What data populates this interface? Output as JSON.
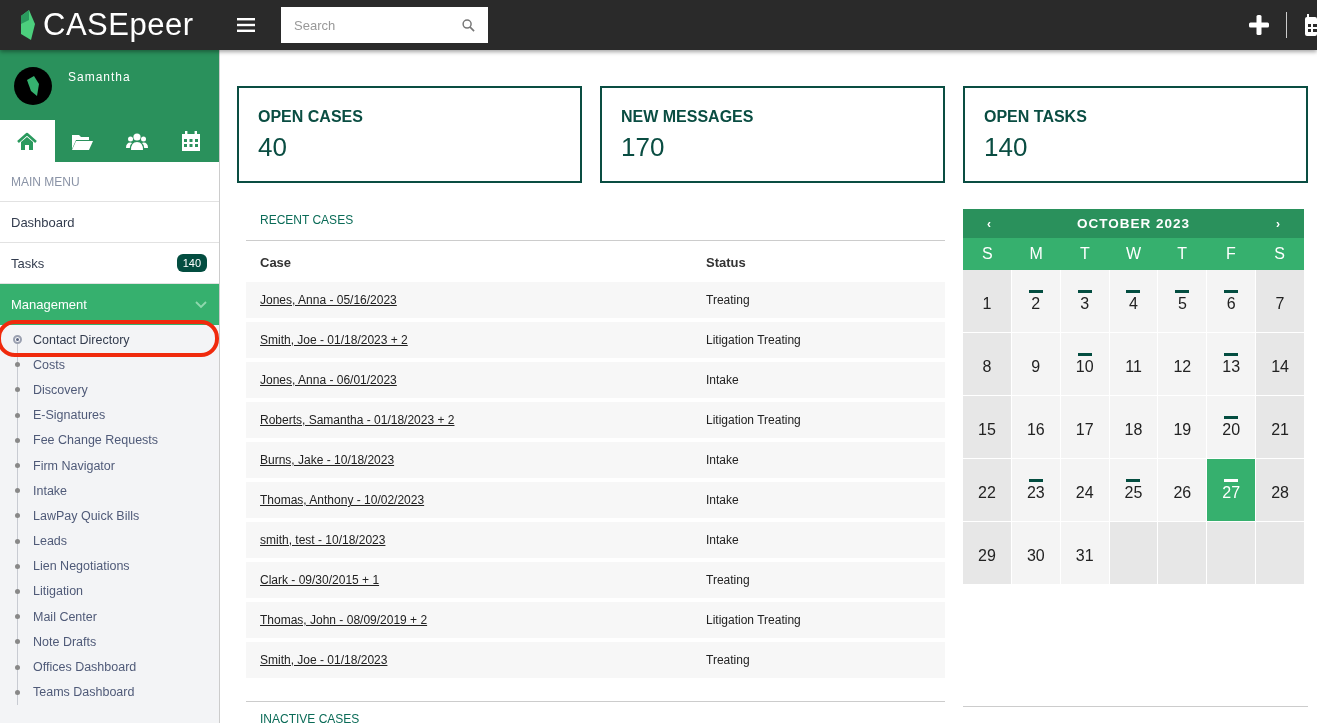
{
  "header": {
    "brand": "CASEpeer",
    "search": {
      "placeholder": "Search"
    }
  },
  "user": {
    "name": "Samantha"
  },
  "sidebar_tabs": [
    {
      "selected": true
    },
    {
      "selected": false
    },
    {
      "selected": false
    },
    {
      "selected": false
    }
  ],
  "sidebar": {
    "heading": "MAIN MENU",
    "items": [
      {
        "label": "Dashboard",
        "selected": false
      },
      {
        "label": "Tasks",
        "badge": "140",
        "selected": false
      },
      {
        "label": "Management",
        "selected": true,
        "expanded": true,
        "children": [
          {
            "label": "Contact Directory",
            "selected": true,
            "highlighted": true
          },
          {
            "label": "Costs",
            "selected": false
          },
          {
            "label": "Discovery",
            "selected": false
          },
          {
            "label": "E-Signatures",
            "selected": false
          },
          {
            "label": "Fee Change Requests",
            "selected": false
          },
          {
            "label": "Firm Navigator",
            "selected": false
          },
          {
            "label": "Intake",
            "selected": false
          },
          {
            "label": "LawPay Quick Bills",
            "selected": false
          },
          {
            "label": "Leads",
            "selected": false
          },
          {
            "label": "Lien Negotiations",
            "selected": false
          },
          {
            "label": "Litigation",
            "selected": false
          },
          {
            "label": "Mail Center",
            "selected": false
          },
          {
            "label": "Note Drafts",
            "selected": false
          },
          {
            "label": "Offices Dashboard",
            "selected": false
          },
          {
            "label": "Teams Dashboard",
            "selected": false
          }
        ]
      }
    ]
  },
  "stats": [
    {
      "label": "OPEN CASES",
      "value": "40"
    },
    {
      "label": "NEW MESSAGES",
      "value": "170"
    },
    {
      "label": "OPEN TASKS",
      "value": "140"
    }
  ],
  "recent_cases": {
    "title": "RECENT CASES",
    "columns": [
      "Case",
      "Status"
    ],
    "rows": [
      [
        "Jones, Anna - 05/16/2023",
        "Treating"
      ],
      [
        "Smith, Joe - 01/18/2023 + 2",
        "Litigation Treating"
      ],
      [
        "Jones, Anna - 06/01/2023",
        "Intake"
      ],
      [
        "Roberts, Samantha - 01/18/2023 + 2",
        "Litigation Treating"
      ],
      [
        "Burns, Jake - 10/18/2023",
        "Intake"
      ],
      [
        "Thomas, Anthony - 10/02/2023",
        "Intake"
      ],
      [
        "smith, test - 10/18/2023",
        "Intake"
      ],
      [
        "Clark - 09/30/2015 + 1",
        "Treating"
      ],
      [
        "Thomas, John - 08/09/2019 + 2",
        "Litigation Treating"
      ],
      [
        "Smith, Joe - 01/18/2023",
        "Treating"
      ]
    ]
  },
  "inactive_cases": {
    "title": "INACTIVE CASES"
  },
  "calendar": {
    "prev": "‹",
    "title": "OCTOBER 2023",
    "next": "›",
    "weekdays": [
      "S",
      "M",
      "T",
      "W",
      "T",
      "F",
      "S"
    ],
    "days": [
      {
        "day": "1",
        "event": false,
        "selected": false
      },
      {
        "day": "2",
        "event": true,
        "selected": false
      },
      {
        "day": "3",
        "event": true,
        "selected": false
      },
      {
        "day": "4",
        "event": true,
        "selected": false
      },
      {
        "day": "5",
        "event": true,
        "selected": false
      },
      {
        "day": "6",
        "event": true,
        "selected": false
      },
      {
        "day": "7",
        "event": false,
        "selected": false
      },
      {
        "day": "8",
        "event": false,
        "selected": false
      },
      {
        "day": "9",
        "event": false,
        "selected": false
      },
      {
        "day": "10",
        "event": true,
        "selected": false
      },
      {
        "day": "11",
        "event": false,
        "selected": false
      },
      {
        "day": "12",
        "event": false,
        "selected": false
      },
      {
        "day": "13",
        "event": true,
        "selected": false
      },
      {
        "day": "14",
        "event": false,
        "selected": false
      },
      {
        "day": "15",
        "event": false,
        "selected": false
      },
      {
        "day": "16",
        "event": false,
        "selected": false
      },
      {
        "day": "17",
        "event": false,
        "selected": false
      },
      {
        "day": "18",
        "event": false,
        "selected": false
      },
      {
        "day": "19",
        "event": false,
        "selected": false
      },
      {
        "day": "20",
        "event": true,
        "selected": false
      },
      {
        "day": "21",
        "event": false,
        "selected": false
      },
      {
        "day": "22",
        "event": false,
        "selected": false
      },
      {
        "day": "23",
        "event": true,
        "selected": false
      },
      {
        "day": "24",
        "event": false,
        "selected": false
      },
      {
        "day": "25",
        "event": true,
        "selected": false
      },
      {
        "day": "26",
        "event": false,
        "selected": false
      },
      {
        "day": "27",
        "event": true,
        "selected": true
      },
      {
        "day": "28",
        "event": false,
        "selected": false
      },
      {
        "day": "29",
        "event": false,
        "selected": false
      },
      {
        "day": "30",
        "event": false,
        "selected": false
      },
      {
        "day": "31",
        "event": false,
        "selected": false
      }
    ]
  }
}
